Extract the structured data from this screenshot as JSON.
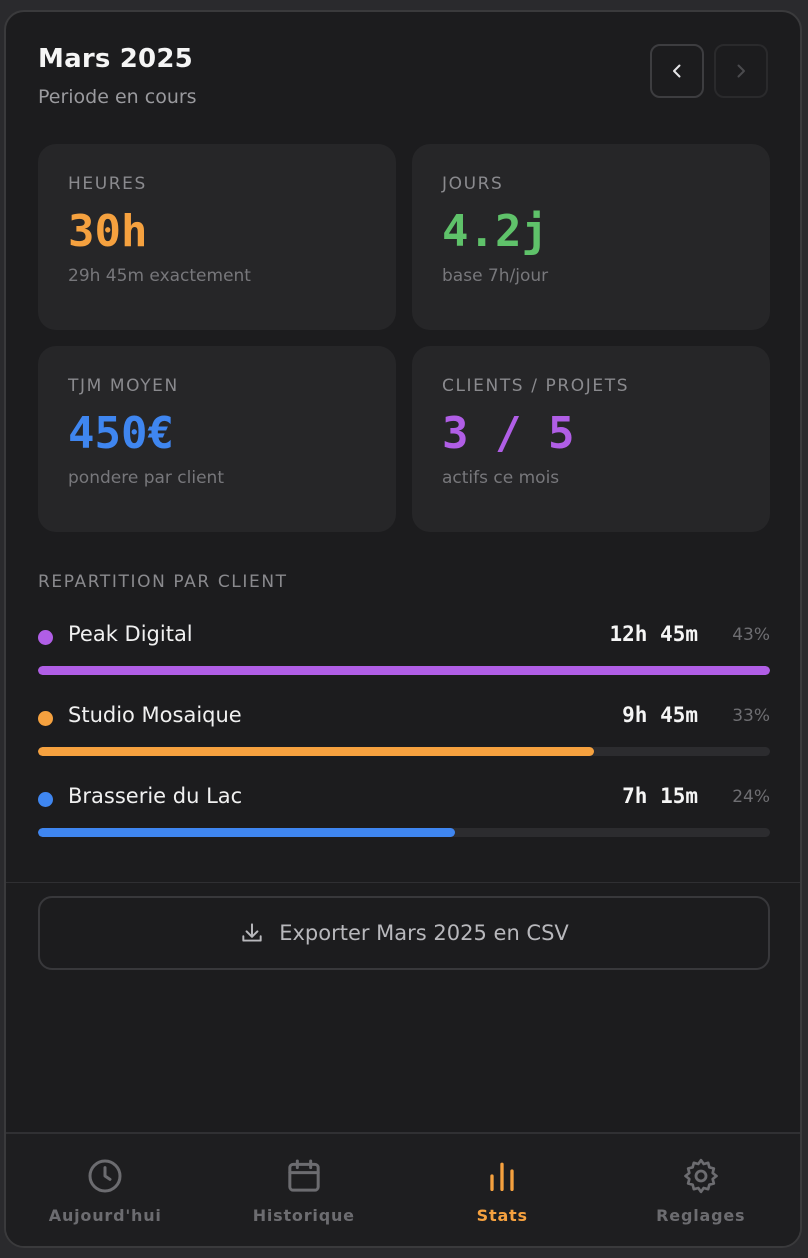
{
  "header": {
    "title": "Mars 2025",
    "subtitle": "Periode en cours"
  },
  "cards": [
    {
      "label": "HEURES",
      "value": "30h",
      "note": "29h 45m exactement",
      "color": "#f5a13f"
    },
    {
      "label": "JOURS",
      "value": "4.2j",
      "note": "base 7h/jour",
      "color": "#5fc26a"
    },
    {
      "label": "TJM MOYEN",
      "value": "450€",
      "note": "pondere par client",
      "color": "#3f86f0"
    },
    {
      "label": "CLIENTS / PROJETS",
      "value": "3 / 5",
      "note": "actifs ce mois",
      "color": "#b05ee6"
    }
  ],
  "breakdown": {
    "title": "REPARTITION PAR CLIENT",
    "clients": [
      {
        "name": "Peak Digital",
        "hours": "12h 45m",
        "percent": "43%",
        "fill": 1.0,
        "color": "#b05ee6"
      },
      {
        "name": "Studio Mosaique",
        "hours": "9h 45m",
        "percent": "33%",
        "fill": 0.76,
        "color": "#f5a13f"
      },
      {
        "name": "Brasserie du Lac",
        "hours": "7h 15m",
        "percent": "24%",
        "fill": 0.57,
        "color": "#3f86f0"
      }
    ]
  },
  "export": {
    "label": "Exporter Mars 2025 en CSV",
    "icon": "download-icon"
  },
  "tabs": [
    {
      "label": "Aujourd'hui",
      "icon": "clock-icon",
      "active": false
    },
    {
      "label": "Historique",
      "icon": "calendar-icon",
      "active": false
    },
    {
      "label": "Stats",
      "icon": "bar-chart-icon",
      "active": true
    },
    {
      "label": "Reglages",
      "icon": "gear-icon",
      "active": false
    }
  ],
  "colors": {
    "accent": "#f5a13f",
    "inactive": "#6c6c70"
  }
}
